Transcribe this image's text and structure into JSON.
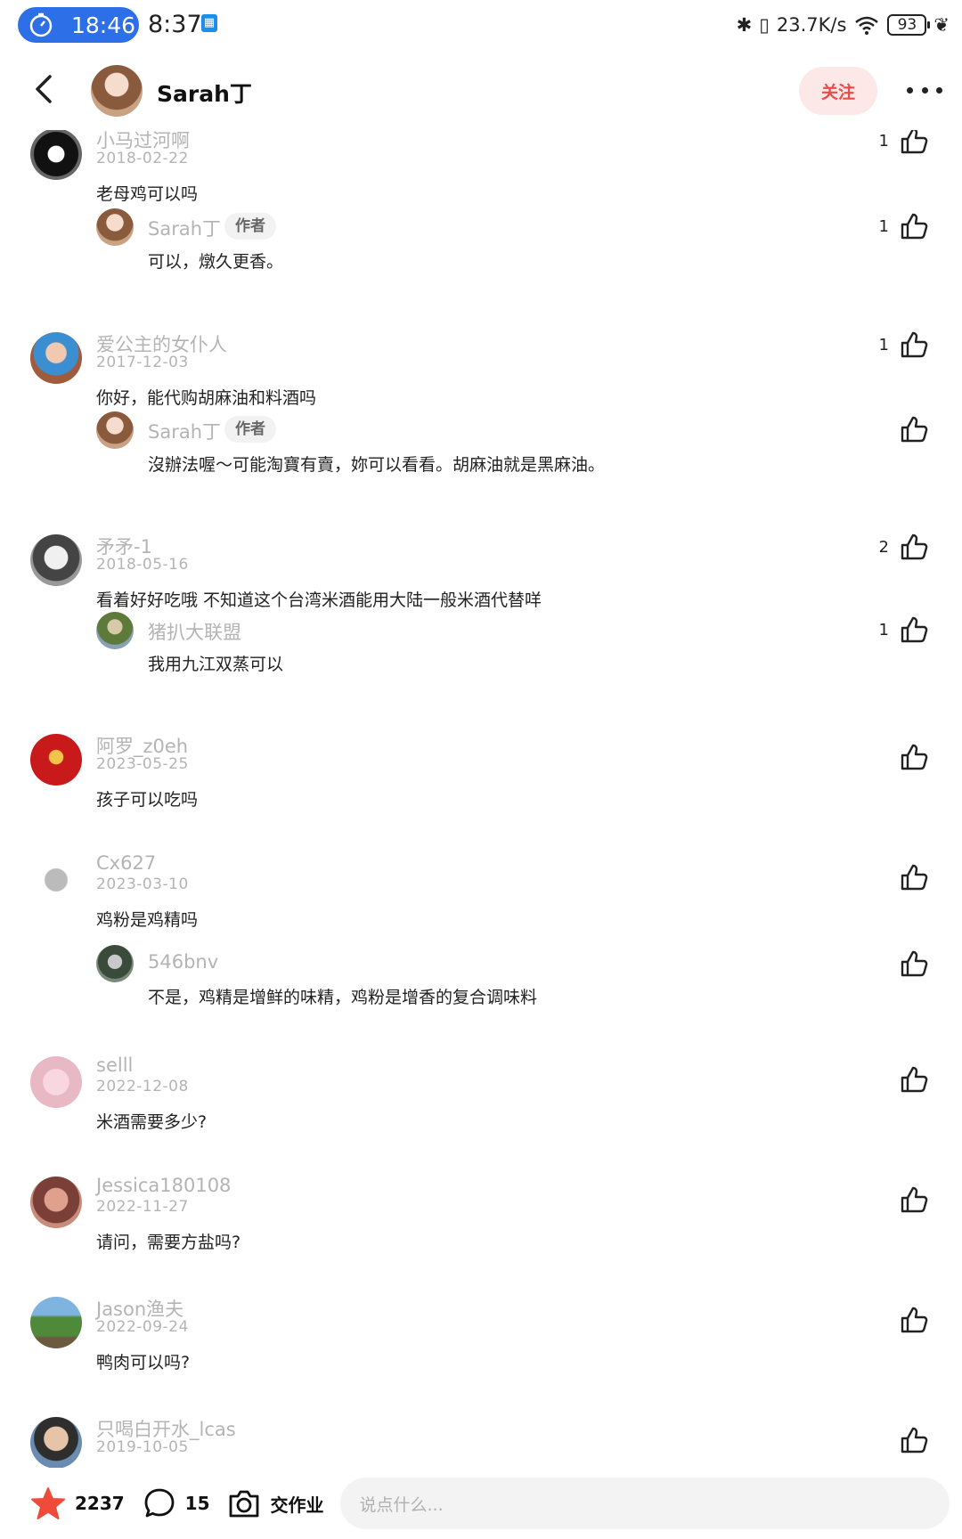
{
  "status_bar": {
    "timer": "18:46",
    "time": "8:37",
    "net_speed": "23.7K/s",
    "battery": "93"
  },
  "header": {
    "title": "Sarah丁",
    "follow_label": "关注"
  },
  "author_tag": "作者",
  "comments": [
    {
      "user": "小马过河啊",
      "date": "2018-02-22",
      "text": "老母鸡可以吗",
      "likes": "1",
      "reply": {
        "user": "Sarah丁",
        "author": true,
        "text": "可以，燉久更香。",
        "likes": "1"
      }
    },
    {
      "user": "爱公主的女仆人",
      "date": "2017-12-03",
      "text": "你好，能代购胡麻油和料酒吗",
      "likes": "1",
      "reply": {
        "user": "Sarah丁",
        "author": true,
        "text": "沒辦法喔～可能淘寶有賣，妳可以看看。胡麻油就是黑麻油。",
        "likes": ""
      }
    },
    {
      "user": "矛矛-1",
      "date": "2018-05-16",
      "text": "看着好好吃哦 不知道这个台湾米酒能用大陆一般米酒代替咩",
      "likes": "2",
      "reply": {
        "user": "猪扒大联盟",
        "author": false,
        "text": "我用九江双蒸可以",
        "likes": "1"
      }
    },
    {
      "user": "阿罗_z0eh",
      "date": "2023-05-25",
      "text": "孩子可以吃吗",
      "likes": ""
    },
    {
      "user": "Cx627",
      "date": "2023-03-10",
      "text": "鸡粉是鸡精吗",
      "likes": "",
      "reply": {
        "user": "546bnv",
        "author": false,
        "text": "不是，鸡精是增鲜的味精，鸡粉是增香的复合调味料",
        "likes": ""
      }
    },
    {
      "user": "selll",
      "date": "2022-12-08",
      "text": "米酒需要多少?",
      "likes": ""
    },
    {
      "user": "Jessica180108",
      "date": "2022-11-27",
      "text": "请问，需要方盐吗?",
      "likes": ""
    },
    {
      "user": "Jason渔夫",
      "date": "2022-09-24",
      "text": "鸭肉可以吗?",
      "likes": ""
    },
    {
      "user": "只喝白开水_lcas",
      "date": "2019-10-05",
      "text": "",
      "likes": ""
    }
  ],
  "bottom_bar": {
    "stars": "2237",
    "comments": "15",
    "homework_label": "交作业",
    "input_placeholder": "说点什么..."
  },
  "icons": {
    "back": "chevron-left-icon",
    "more": "more-dots-icon",
    "like": "thumbs-up-icon",
    "star": "star-icon",
    "comment": "comment-bubble-icon",
    "camera": "camera-icon"
  },
  "colors": {
    "accent_red": "#e94b4b",
    "follow_bg": "#fde8e8",
    "timer_blue": "#2d6fe6",
    "star_red": "#f04a3a",
    "muted_text": "#b4b4b4"
  }
}
